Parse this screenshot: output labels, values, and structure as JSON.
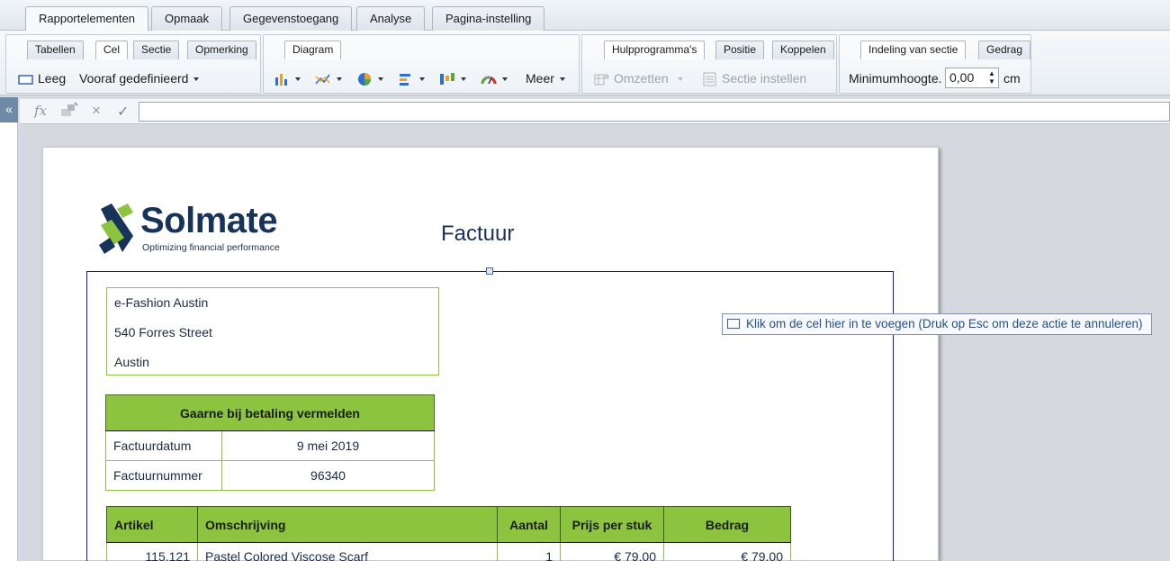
{
  "top_tabs": [
    "Rapportelementen",
    "Opmaak",
    "Gegevenstoegang",
    "Analyse",
    "Pagina-instelling"
  ],
  "ribbon": {
    "subtabs": {
      "g1": [
        "Tabellen",
        "Cel",
        "Sectie",
        "Opmerking"
      ],
      "g2": [
        "Diagram"
      ],
      "g3": [
        "Hulpprogramma's",
        "Positie",
        "Koppelen"
      ],
      "g4": [
        "Indeling van sectie",
        "Gedrag"
      ]
    },
    "empty_label": "Leeg",
    "predefined_label": "Vooraf gedefinieerd",
    "more_label": "Meer",
    "convert_label": "Omzetten",
    "section_setup_label": "Sectie instellen",
    "min_height_label": "Minimumhoogte.",
    "min_height_value": "0,00",
    "unit_label": "cm"
  },
  "collapse_label": "«",
  "formula": {
    "fx_label": "fx",
    "cancel_label": "×",
    "confirm_label": "✓"
  },
  "report": {
    "logo_word": "Solmate",
    "logo_tagline": "Optimizing financial performance",
    "title": "Factuur",
    "address": [
      "e-Fashion Austin",
      "540 Forres Street",
      "Austin"
    ],
    "payment_header": "Gaarne bij betaling vermelden",
    "payment_rows": [
      {
        "label": "Factuurdatum",
        "value": "9 mei 2019"
      },
      {
        "label": "Factuurnummer",
        "value": "96340"
      }
    ],
    "items_columns": [
      "Artikel",
      "Omschrijving",
      "Aantal",
      "Prijs per stuk",
      "Bedrag"
    ],
    "items_rows": [
      {
        "artikel": "115.121",
        "omschrijving": "Pastel Colored Viscose Scarf",
        "aantal": "1",
        "prijs": "€ 79.00",
        "bedrag": "€ 79.00"
      }
    ]
  },
  "tooltip_text": "Klik om de cel hier in te voegen (Druk op Esc om deze actie te annuleren)",
  "colors": {
    "green_accent": "#8cc43f",
    "navy_text": "#17335a",
    "tooltip_text": "#1f4e9a"
  }
}
